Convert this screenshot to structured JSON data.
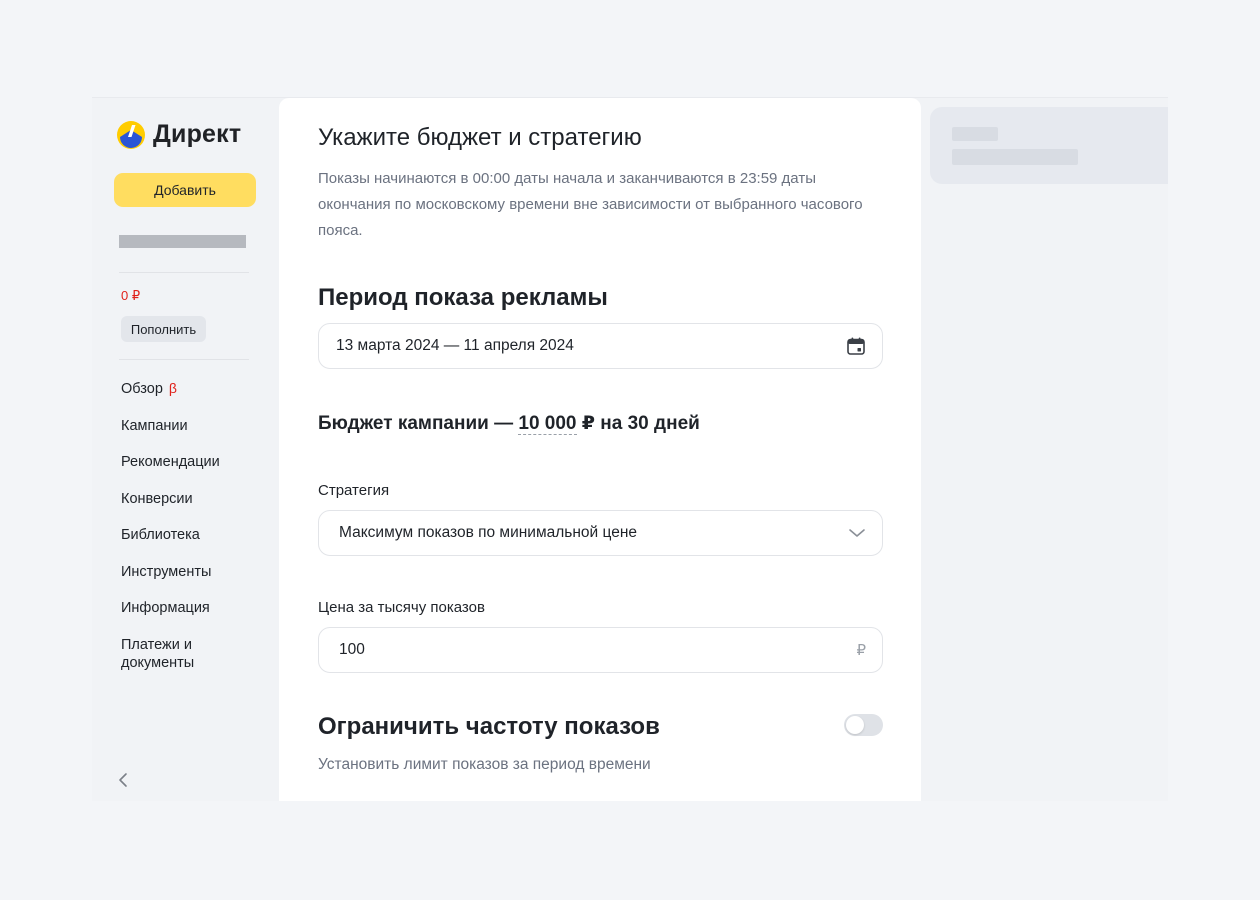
{
  "sidebar": {
    "logo_text": "Директ",
    "add_button": "Добавить",
    "balance": "0 ₽",
    "topup_button": "Пополнить",
    "nav": {
      "overview": "Обзор",
      "beta": "β",
      "campaigns": "Кампании",
      "recommendations": "Рекомендации",
      "conversions": "Конверсии",
      "library": "Библиотека",
      "tools": "Инструменты",
      "info": "Информация",
      "payments": "Платежи и документы"
    },
    "collapse_icon": "chevron-left-icon"
  },
  "main": {
    "title": "Укажите бюджет и стратегию",
    "description": "Показы начинаются в 00:00 даты начала и заканчиваются в 23:59 даты окончания по московскому времени вне зависимости от выбранного часового пояса.",
    "period_title": "Период показа рекламы",
    "period_value": "13 марта 2024 — 11 апреля 2024",
    "period_icon": "calendar-icon",
    "budget_prefix": "Бюджет кампании —",
    "budget_amount": "10 000",
    "budget_suffix": "₽ на 30 дней",
    "strategy_label": "Стратегия",
    "strategy_value": "Максимум показов по минимальной цене",
    "strategy_icon": "chevron-down-icon",
    "price_label": "Цена за тысячу показов",
    "price_value": "100",
    "price_currency": "₽",
    "frequency_title": "Ограничить частоту показов",
    "frequency_hint": "Установить лимит показов за период времени",
    "frequency_enabled": false
  },
  "colors": {
    "accent": "#ffdd60",
    "balance": "#e0221c",
    "background": "#f3f5f8",
    "card": "#ffffff"
  }
}
